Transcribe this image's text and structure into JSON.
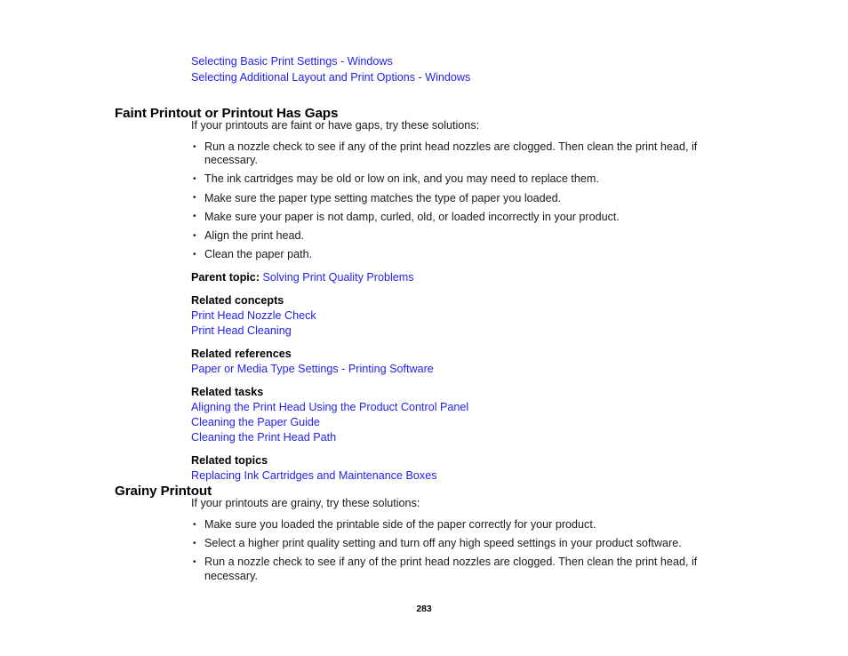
{
  "page": {
    "number": "283",
    "link_color": "#2222ee",
    "text_color": "#1a1a1a",
    "background": "#ffffff"
  },
  "top_links": [
    {
      "text": "Selecting Basic Print Settings - Windows"
    },
    {
      "text": "Selecting Additional Layout and Print Options - Windows"
    }
  ],
  "sections": [
    {
      "heading": "Faint Printout or Printout Has Gaps",
      "intro": "If your printouts are faint or have gaps, try these solutions:",
      "bullets": [
        "Run a nozzle check to see if any of the print head nozzles are clogged. Then clean the print head, if necessary.",
        "The ink cartridges may be old or low on ink, and you may need to replace them.",
        "Make sure the paper type setting matches the type of paper you loaded.",
        "Make sure your paper is not damp, curled, old, or loaded incorrectly in your product.",
        "Align the print head.",
        "Clean the paper path."
      ],
      "parent_topic": {
        "label": "Parent topic:",
        "link": "Solving Print Quality Problems"
      },
      "related": [
        {
          "title": "Related concepts",
          "links": [
            "Print Head Nozzle Check",
            "Print Head Cleaning"
          ]
        },
        {
          "title": "Related references",
          "links": [
            "Paper or Media Type Settings - Printing Software"
          ]
        },
        {
          "title": "Related tasks",
          "links": [
            "Aligning the Print Head Using the Product Control Panel",
            "Cleaning the Paper Guide",
            "Cleaning the Print Head Path"
          ]
        },
        {
          "title": "Related topics",
          "links": [
            "Replacing Ink Cartridges and Maintenance Boxes"
          ]
        }
      ]
    },
    {
      "heading": "Grainy Printout",
      "intro": "If your printouts are grainy, try these solutions:",
      "bullets": [
        "Make sure you loaded the printable side of the paper correctly for your product.",
        "Select a higher print quality setting and turn off any high speed settings in your product software.",
        "Run a nozzle check to see if any of the print head nozzles are clogged. Then clean the print head, if necessary."
      ]
    }
  ]
}
